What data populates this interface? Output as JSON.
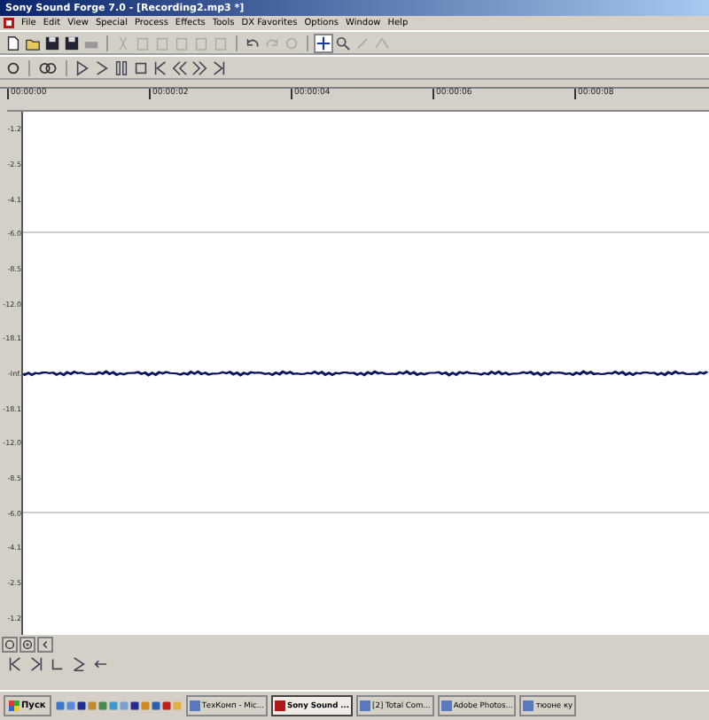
{
  "window": {
    "title": "Sony Sound Forge 7.0 - [Recording2.mp3 *]"
  },
  "menu": [
    "File",
    "Edit",
    "View",
    "Special",
    "Process",
    "Effects",
    "Tools",
    "DX Favorites",
    "Options",
    "Window",
    "Help"
  ],
  "ruler": [
    "00:00:00",
    "00:00:02",
    "00:00:04",
    "00:00:06",
    "00:00:08"
  ],
  "levels": [
    {
      "label": "-1.2"
    },
    {
      "label": "-2.5"
    },
    {
      "label": "-4.1"
    },
    {
      "label": "-6.0"
    },
    {
      "label": "-8.5"
    },
    {
      "label": "-12.0"
    },
    {
      "label": "-18.1"
    },
    {
      "label": "-Inf."
    },
    {
      "label": "-18.1"
    },
    {
      "label": "-12.0"
    },
    {
      "label": "-8.5"
    },
    {
      "label": "-6.0"
    },
    {
      "label": "-4.1"
    },
    {
      "label": "-2.5"
    },
    {
      "label": "-1.2"
    }
  ],
  "taskbar": {
    "start": "Пуск",
    "tasks": [
      {
        "label": "ТехКомп - Mic...",
        "selected": false
      },
      {
        "label": "Sony Sound ...",
        "selected": true
      },
      {
        "label": "[2] Total Com...",
        "selected": false
      },
      {
        "label": "Adobe Photos...",
        "selected": false
      },
      {
        "label": "тюоне ку",
        "selected": false
      }
    ]
  }
}
